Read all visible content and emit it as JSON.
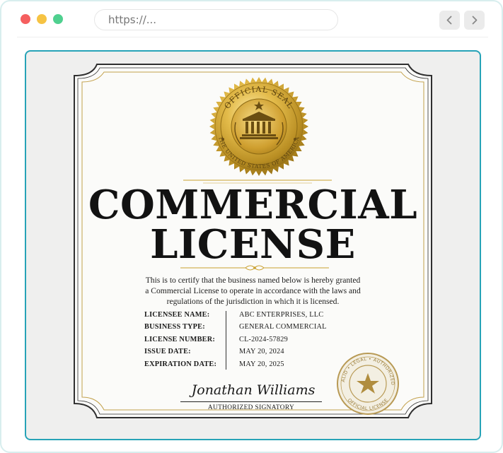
{
  "browser": {
    "url": "https://...",
    "back_icon": "chevron-left-icon",
    "forward_icon": "chevron-right-icon"
  },
  "certificate": {
    "seal": {
      "top_text": "OFFICIAL SEAL",
      "bottom_text": "THE UNITED STATES OF AMERICA",
      "icon": "courthouse-icon"
    },
    "title_line1": "COMMERCIAL",
    "title_line2": "LICENSE",
    "intro_line1": "This is to certify that the business named below is hereby granted",
    "intro_line2": "a Commercial License to operate in accordance with the laws and",
    "intro_line3": "regulations of the jurisdiction in which it is licensed.",
    "fields": [
      {
        "label": "LICENSEE NAME:",
        "value": "ABC ENTERPRISES, LLC"
      },
      {
        "label": "BUSINESS TYPE:",
        "value": "GENERAL COMMERCIAL"
      },
      {
        "label": "LICENSE NUMBER:",
        "value": "CL-2024-57829"
      },
      {
        "label": "ISSUE DATE:",
        "value": "MAY 20, 2024"
      },
      {
        "label": "EXPIRATION DATE:",
        "value": "MAY 20, 2025"
      }
    ],
    "signature_name": "Jonathan Williams",
    "signature_caption": "AUTHORIZED SIGNATORY",
    "stamp": {
      "top_text": "VALID • LEGAL • AUTHORIZED",
      "bottom_text": "OFFICIAL LICENSE",
      "icon": "star-icon"
    }
  },
  "colors": {
    "frame_accent": "#27a3b7",
    "gold": "#c9a02e",
    "stamp_gold": "#b89a55",
    "paper": "#efefee"
  }
}
